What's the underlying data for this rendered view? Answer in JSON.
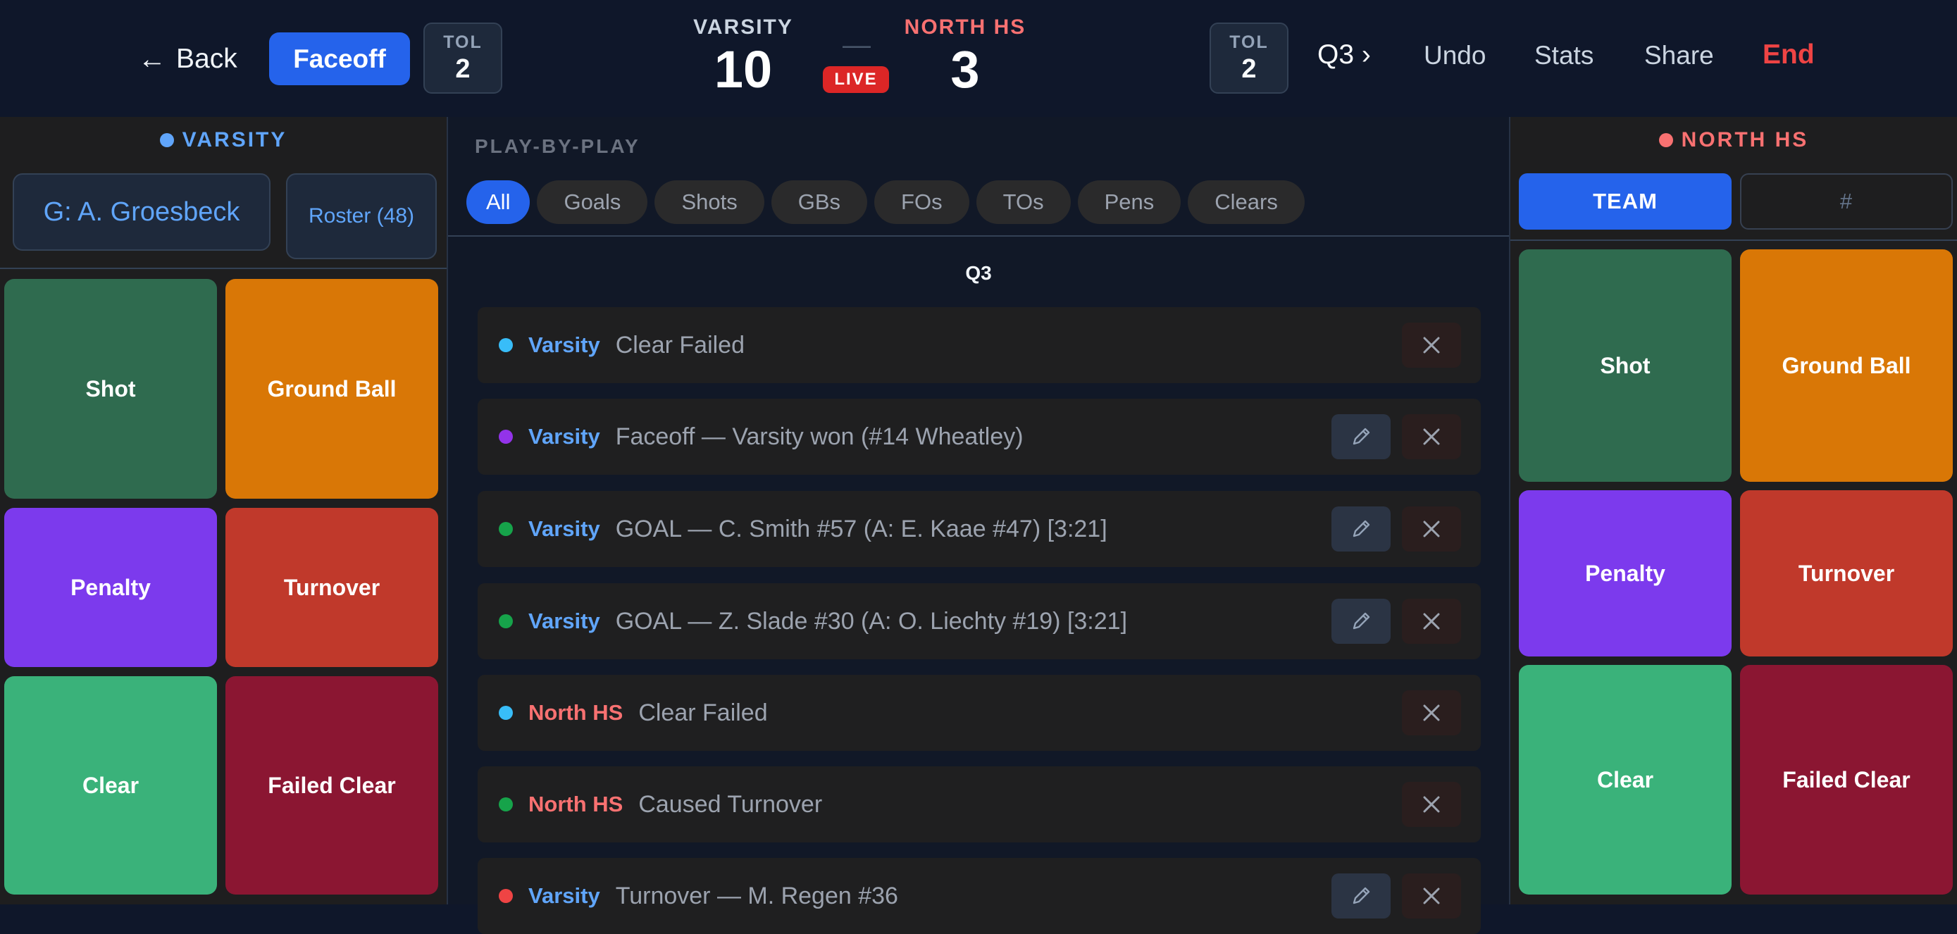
{
  "header": {
    "back_label": "Back",
    "faceoff_label": "Faceoff",
    "tol_left": {
      "label": "TOL",
      "value": "2"
    },
    "tol_right": {
      "label": "TOL",
      "value": "2"
    },
    "home_team": "VARSITY",
    "home_score": "10",
    "away_team": "NORTH HS",
    "away_score": "3",
    "dash": "—",
    "live": "LIVE",
    "quarter": "Q3 ›",
    "undo": "Undo",
    "stats": "Stats",
    "share": "Share",
    "end": "End"
  },
  "left_panel": {
    "title": "VARSITY",
    "goalie": "G: A. Groesbeck",
    "roster": "Roster (48)",
    "tiles": [
      "Shot",
      "Ground Ball",
      "Penalty",
      "Turnover",
      "Clear",
      "Failed Clear"
    ]
  },
  "right_panel": {
    "title": "NORTH HS",
    "toggle_team": "TEAM",
    "toggle_number": "#",
    "tiles": [
      "Shot",
      "Ground Ball",
      "Penalty",
      "Turnover",
      "Clear",
      "Failed Clear"
    ]
  },
  "center": {
    "title": "PLAY-BY-PLAY",
    "filters": [
      "All",
      "Goals",
      "Shots",
      "GBs",
      "FOs",
      "TOs",
      "Pens",
      "Clears"
    ],
    "quarter_label": "Q3",
    "events": [
      {
        "team": "Varsity",
        "desc": "Clear Failed"
      },
      {
        "team": "Varsity",
        "desc": "Faceoff — Varsity won (#14 Wheatley)"
      },
      {
        "team": "Varsity",
        "desc": "GOAL — C. Smith #57 (A: E. Kaae #47) [3:21]"
      },
      {
        "team": "Varsity",
        "desc": "GOAL — Z. Slade #30 (A: O. Liechty #19) [3:21]"
      },
      {
        "team": "North HS",
        "desc": "Clear Failed"
      },
      {
        "team": "North HS",
        "desc": "Caused Turnover"
      },
      {
        "team": "Varsity",
        "desc": "Turnover — M. Regen #36"
      }
    ]
  },
  "colors": {
    "accent": "#2563eb",
    "home": "#60a5fa",
    "away": "#f87171",
    "end": "#ef4444",
    "live": "#dc2626",
    "dot_clear": "#38bdf8",
    "dot_faceoff": "#9333ea",
    "dot_goal": "#16a34a",
    "dot_turnover": "#ef4444"
  },
  "icons": {
    "back": "arrow-left-icon",
    "edit": "pencil-icon",
    "delete": "close-icon"
  }
}
